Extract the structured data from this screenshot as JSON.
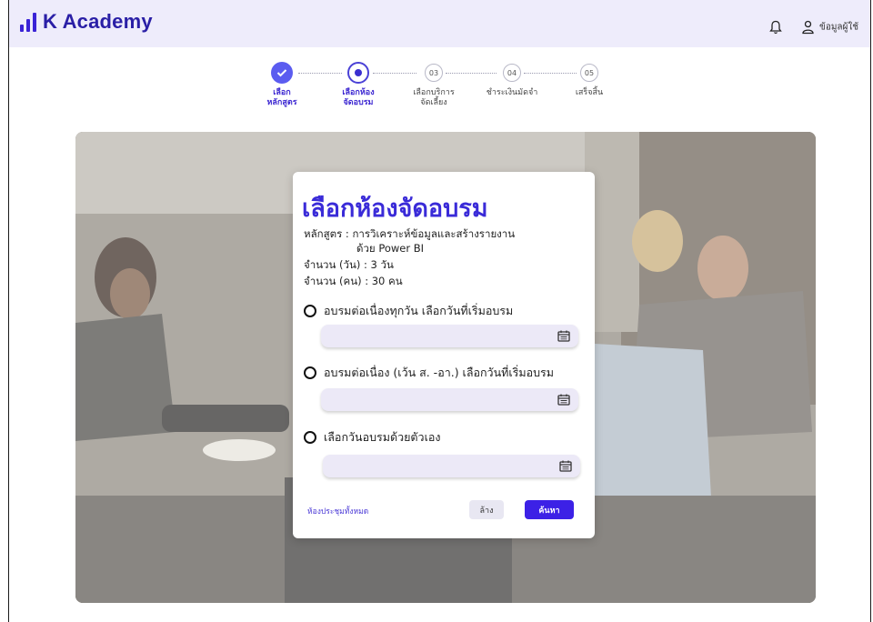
{
  "brand": {
    "name": "K Academy",
    "color": "#3a23d6"
  },
  "header": {
    "bell_icon": "bell-icon",
    "user_icon": "user-icon",
    "user_label": "ข้อมูลผู้ใช้"
  },
  "stepper": {
    "steps": [
      {
        "number": "",
        "label": "เลือก\nหลักสูตร",
        "state": "done"
      },
      {
        "number": "",
        "label": "เลือกห้อง\nจัดอบรม",
        "state": "current"
      },
      {
        "number": "03",
        "label": "เลือกบริการ\nจัดเลี้ยง",
        "state": "todo"
      },
      {
        "number": "04",
        "label": "ชำระเงินมัดจำ",
        "state": "todo"
      },
      {
        "number": "05",
        "label": "เสร็จสิ้น",
        "state": "todo"
      }
    ]
  },
  "dialog": {
    "title": "เลือกห้องจัดอบรม",
    "course_line1": "หลักสูตร : การวิเคราะห์ข้อมูลและสร้างรายงาน",
    "course_line2": "ด้วย Power BI",
    "days": "จำนวน (วัน) : 3 วัน",
    "people": "จำนวน (คน) : 30 คน",
    "options": [
      {
        "label": "อบรมต่อเนื่องทุกวัน  เลือกวันที่เริ่มอบรม",
        "date_value": ""
      },
      {
        "label": "อบรมต่อเนื่อง (เว้น ส. -อา.) เลือกวันที่เริ่มอบรม",
        "date_value": ""
      },
      {
        "label": "เลือกวันอบรมด้วยตัวเอง",
        "date_value": ""
      }
    ],
    "all_rooms_link": "ห้องประชุมทั้งหมด",
    "clear_label": "ล้าง",
    "search_label": "ค้นหา"
  }
}
